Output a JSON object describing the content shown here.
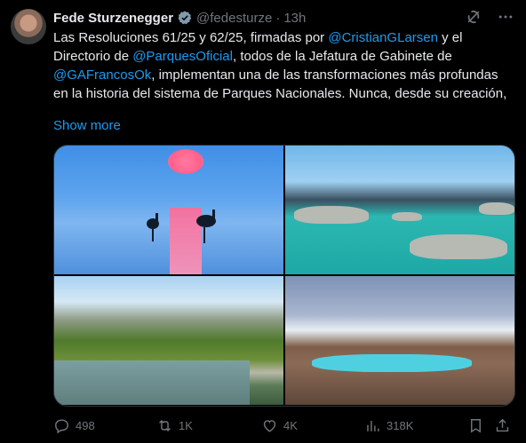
{
  "author": {
    "name": "Fede Sturzenegger",
    "handle": "@fedesturze",
    "separator": "·",
    "time": "13h"
  },
  "tweet": {
    "t1": "Las Resoluciones 61/25 y 62/25, firmadas por ",
    "m1": "@CristianGLarsen",
    "t2": " y el Directorio de ",
    "m2": "@ParquesOficial",
    "t3": ",  todos de la Jefatura de Gabinete de ",
    "m3": "@GAFrancosOk",
    "t4": ", implementan una de las transformaciones más profundas en la historia del sistema de Parques Nacionales. Nunca, desde su creación,",
    "show_more": "Show more"
  },
  "stats": {
    "replies": "498",
    "reposts": "1K",
    "likes": "4K",
    "views": "318K"
  },
  "colors": {
    "background": "#000000",
    "text": "#e7e9ea",
    "muted": "#71767b",
    "link": "#1d9bf0"
  },
  "icons": [
    "verified-badge-icon",
    "grok-icon",
    "more-icon",
    "reply-icon",
    "repost-icon",
    "like-icon",
    "views-icon",
    "bookmark-icon",
    "share-icon"
  ]
}
